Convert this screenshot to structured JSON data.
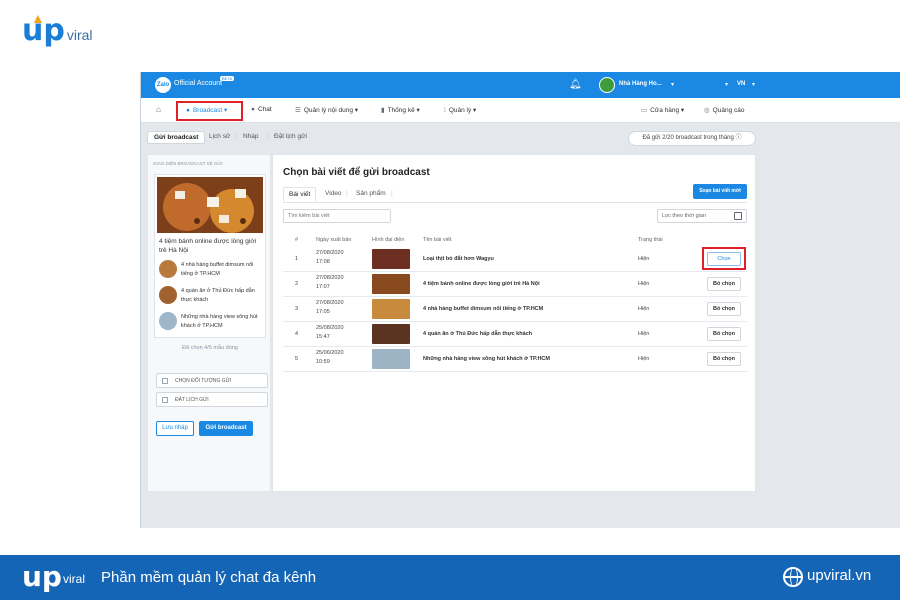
{
  "brand": {
    "name_main": "up",
    "name_sub": "viral"
  },
  "topbar": {
    "app_name": "Official Account",
    "app_badge": "BETA",
    "logo_text": "Zalo",
    "account_name": "Nhà Hàng Ho...",
    "language": "VN"
  },
  "nav": {
    "items": [
      {
        "label": "Broadcast",
        "icon": "broadcast-icon"
      },
      {
        "label": "Chat",
        "icon": "chat-icon"
      },
      {
        "label": "Quản lý nội dung",
        "icon": "list-icon"
      },
      {
        "label": "Thống kê",
        "icon": "bar-chart-icon"
      },
      {
        "label": "Quản lý",
        "icon": "grid-icon"
      }
    ],
    "right": [
      {
        "label": "Cửa hàng",
        "icon": "store-icon"
      },
      {
        "label": "Quảng cáo",
        "icon": "ads-icon"
      }
    ]
  },
  "subtabs": [
    "Gửi broadcast",
    "Lịch sử",
    "Nháp",
    "Đặt lịch gửi"
  ],
  "quota": "Đã gửi 2/20 broadcast trong tháng",
  "left_panel": {
    "title": "GIAO DIỆN BROADCAST SẼ GỬI",
    "main_title": "4 tiệm bánh online được lòng giới trẻ Hà Nội",
    "sub_items": [
      "4 nhà hàng buffet dimsum nổi tiếng ở TP.HCM",
      "4 quán ăn ở Thủ Đức hấp dẫn thực khách",
      "Những nhà hàng view sông hút khách ở TP.HCM"
    ],
    "count": "Đã chọn 4/5 mẫu dùng",
    "checks": [
      "CHỌN ĐỐI TƯỢNG GỬI",
      "ĐẶT LỊCH GỬI"
    ],
    "draft_button": "Lưu nháp",
    "send_button": "Gửi broadcast"
  },
  "right_panel": {
    "title": "Chọn bài viết để gửi broadcast",
    "tabs": [
      "Bài viết",
      "Video",
      "Sản phẩm"
    ],
    "compose_button": "Soạn bài viết mới",
    "search_placeholder": "Tìm kiếm bài viết",
    "filter_label": "Lọc theo thời gian",
    "columns": [
      "#",
      "Ngày xuất bản",
      "Hình đại diện",
      "Tên bài viết",
      "Trạng thái"
    ],
    "rows": [
      {
        "num": "1",
        "date": "27/08/2020",
        "time": "17:08",
        "title": "Loại thịt bò đắt hơn Wagyu",
        "status": "Hiện",
        "action": "Chọn"
      },
      {
        "num": "2",
        "date": "27/08/2020",
        "time": "17:07",
        "title": "4 tiệm bánh online được lòng giới trẻ Hà Nội",
        "status": "Hiện",
        "action": "Bỏ chọn"
      },
      {
        "num": "3",
        "date": "27/08/2020",
        "time": "17:05",
        "title": "4 nhà hàng buffet dimsum nổi tiếng ở TP.HCM",
        "status": "Hiện",
        "action": "Bỏ chọn"
      },
      {
        "num": "4",
        "date": "25/08/2020",
        "time": "15:47",
        "title": "4 quán ăn ở Thủ Đức hấp dẫn thực khách",
        "status": "Hiện",
        "action": "Bỏ chọn"
      },
      {
        "num": "5",
        "date": "25/06/2020",
        "time": "10:59",
        "title": "Những nhà hàng view sông hút khách ở TP.HCM",
        "status": "Hiện",
        "action": "Bỏ chọn"
      }
    ]
  },
  "footer": {
    "logo_main": "up",
    "logo_sub": "viral",
    "tagline": "Phần mềm quản lý chat đa kênh",
    "website": "upviral.vn"
  },
  "colors": {
    "primary": "#1b89e3",
    "highlight": "#e0202a",
    "footer_bg": "#1565b6"
  }
}
